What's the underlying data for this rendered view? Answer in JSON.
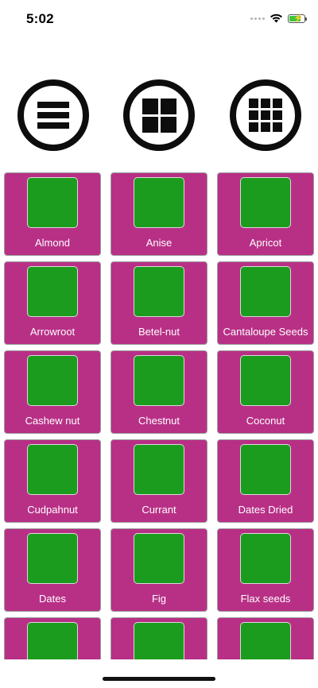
{
  "status_bar": {
    "time": "5:02",
    "icons": [
      "cellular-dots-icon",
      "wifi-icon",
      "battery-charging-icon"
    ],
    "battery_color": "#41c63c"
  },
  "layout_toggle": {
    "buttons": [
      {
        "name": "list-layout",
        "icon": "list-icon"
      },
      {
        "name": "two-column-layout",
        "icon": "grid-2x2-icon"
      },
      {
        "name": "three-column-layout",
        "icon": "grid-3x3-icon"
      }
    ]
  },
  "colors": {
    "card_background": "#b83086",
    "thumbnail": "#1c9c1e",
    "label_text": "#ffffff"
  },
  "items": [
    {
      "label": "Almond"
    },
    {
      "label": "Anise"
    },
    {
      "label": "Apricot"
    },
    {
      "label": "Arrowroot"
    },
    {
      "label": "Betel-nut"
    },
    {
      "label": "Cantaloupe Seeds"
    },
    {
      "label": "Cashew nut"
    },
    {
      "label": "Chestnut"
    },
    {
      "label": "Coconut"
    },
    {
      "label": "Cudpahnut"
    },
    {
      "label": "Currant"
    },
    {
      "label": "Dates Dried"
    },
    {
      "label": "Dates"
    },
    {
      "label": "Fig"
    },
    {
      "label": "Flax seeds"
    },
    {
      "label": ""
    },
    {
      "label": ""
    },
    {
      "label": ""
    }
  ]
}
